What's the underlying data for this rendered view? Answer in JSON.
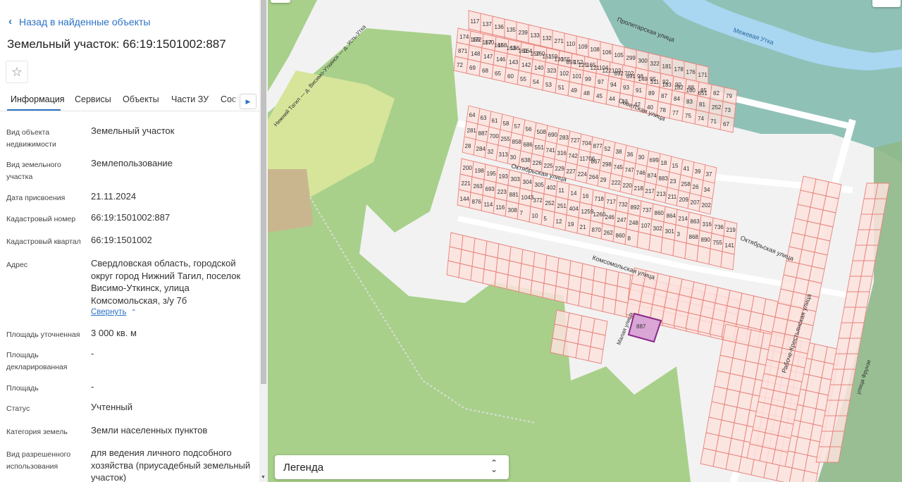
{
  "panel": {
    "back_label": "Назад в найденные объекты",
    "title": "Земельный участок: 66:19:1501002:887",
    "tabs": [
      "Информация",
      "Сервисы",
      "Объекты",
      "Части ЗУ",
      "Соста"
    ],
    "active_tab": "Информация",
    "fields": [
      {
        "label": "Вид объекта недвижимости",
        "value": "Земельный участок"
      },
      {
        "label": "Вид земельного участка",
        "value": "Землепользование"
      },
      {
        "label": "Дата присвоения",
        "value": "21.11.2024"
      },
      {
        "label": "Кадастровый номер",
        "value": "66:19:1501002:887"
      },
      {
        "label": "Кадастровый квартал",
        "value": "66:19:1501002"
      },
      {
        "label": "Адрес",
        "value": "Свердловская область, городской округ город Нижний Тагил, поселок Висимо-Уткинск, улица Комсомольская, з/у 7б"
      },
      {
        "label": "Площадь уточненная",
        "value": "3 000 кв. м"
      },
      {
        "label": "Площадь декларированная",
        "value": "-"
      },
      {
        "label": "Площадь",
        "value": "-"
      },
      {
        "label": "Статус",
        "value": "Учтенный"
      },
      {
        "label": "Категория земель",
        "value": "Земли населенных пунктов"
      },
      {
        "label": "Вид разрешенного использования",
        "value": "для ведения личного подсобного хозяйства (приусадебный земельный участок)"
      }
    ],
    "collapse_label": "Свернуть"
  },
  "map": {
    "legend_label": "Легенда",
    "streets": [
      "Октябрьская улица",
      "Октябрьская улица",
      "Комсомольская улица",
      "Советская улица",
      "Пролетарская улица",
      "Малая улица",
      "Рабоче-Крестьянская улица",
      "улица Фрунзе",
      "Нижний Тагил — д. Висимо-Уткинск — д. Усть-Утка"
    ],
    "river_label": "Межевая Утка",
    "selected_parcel": "887",
    "parcel_numbers": [
      "117",
      "137",
      "136",
      "135",
      "239",
      "133",
      "132",
      "271",
      "110",
      "109",
      "108",
      "106",
      "105",
      "299",
      "300",
      "322",
      "181",
      "178",
      "176",
      "171",
      "169",
      "167",
      "165",
      "163",
      "161",
      "157",
      "151",
      "130",
      "859",
      "125",
      "121",
      "122",
      "692",
      "691",
      "149",
      "311",
      "183",
      "182",
      "180",
      "651",
      "174",
      "172",
      "170",
      "168",
      "166",
      "164",
      "160",
      "159",
      "155",
      "152",
      "165",
      "104",
      "103",
      "702",
      "98",
      "95",
      "92",
      "90",
      "88",
      "85",
      "82",
      "79",
      "871",
      "148",
      "147",
      "146",
      "143",
      "142",
      "140",
      "323",
      "102",
      "101",
      "99",
      "97",
      "94",
      "93",
      "91",
      "89",
      "87",
      "84",
      "83",
      "81",
      "252",
      "73",
      "72",
      "69",
      "68",
      "65",
      "60",
      "55",
      "54",
      "53",
      "51",
      "49",
      "48",
      "45",
      "44",
      "43",
      "42",
      "40",
      "78",
      "77",
      "75",
      "74",
      "71",
      "67",
      "64",
      "63",
      "61",
      "58",
      "57",
      "56",
      "508",
      "690",
      "283",
      "727",
      "704",
      "877",
      "52",
      "38",
      "36",
      "30",
      "699",
      "18",
      "15",
      "41",
      "39",
      "37",
      "281",
      "887",
      "700",
      "255",
      "858",
      "686",
      "551",
      "741",
      "316",
      "742",
      "11706",
      "867",
      "298",
      "745",
      "747",
      "746",
      "874",
      "883",
      "23",
      "258",
      "26",
      "34",
      "28",
      "284",
      "32",
      "313",
      "30",
      "638",
      "226",
      "225",
      "229",
      "227",
      "224",
      "264",
      "29",
      "222",
      "220",
      "218",
      "217",
      "213",
      "211",
      "209",
      "207",
      "202",
      "200",
      "198",
      "195",
      "193",
      "303",
      "304",
      "305",
      "402",
      "11",
      "14",
      "16",
      "718",
      "717",
      "732",
      "892",
      "737",
      "860",
      "864",
      "214",
      "863",
      "316",
      "736",
      "219",
      "221",
      "263",
      "693",
      "223",
      "881",
      "1043",
      "372",
      "252",
      "251",
      "404",
      "1259",
      "1260",
      "246",
      "247",
      "248",
      "107",
      "302",
      "301",
      "3",
      "868",
      "890",
      "755",
      "141",
      "144",
      "876",
      "114",
      "116",
      "308",
      "7",
      "10",
      "5",
      "12",
      "19",
      "21",
      "870",
      "262",
      "860",
      "8"
    ]
  },
  "colors": {
    "accent": "#2b73c6",
    "forest": "#a8d08a",
    "parcel_fill": "#fbe3de",
    "parcel_stroke": "#e8837a",
    "selected_fill": "#d9a6d6",
    "selected_stroke": "#8a2a8a",
    "teal_zone": "#7fb8ad",
    "river": "#a9d6f0"
  }
}
